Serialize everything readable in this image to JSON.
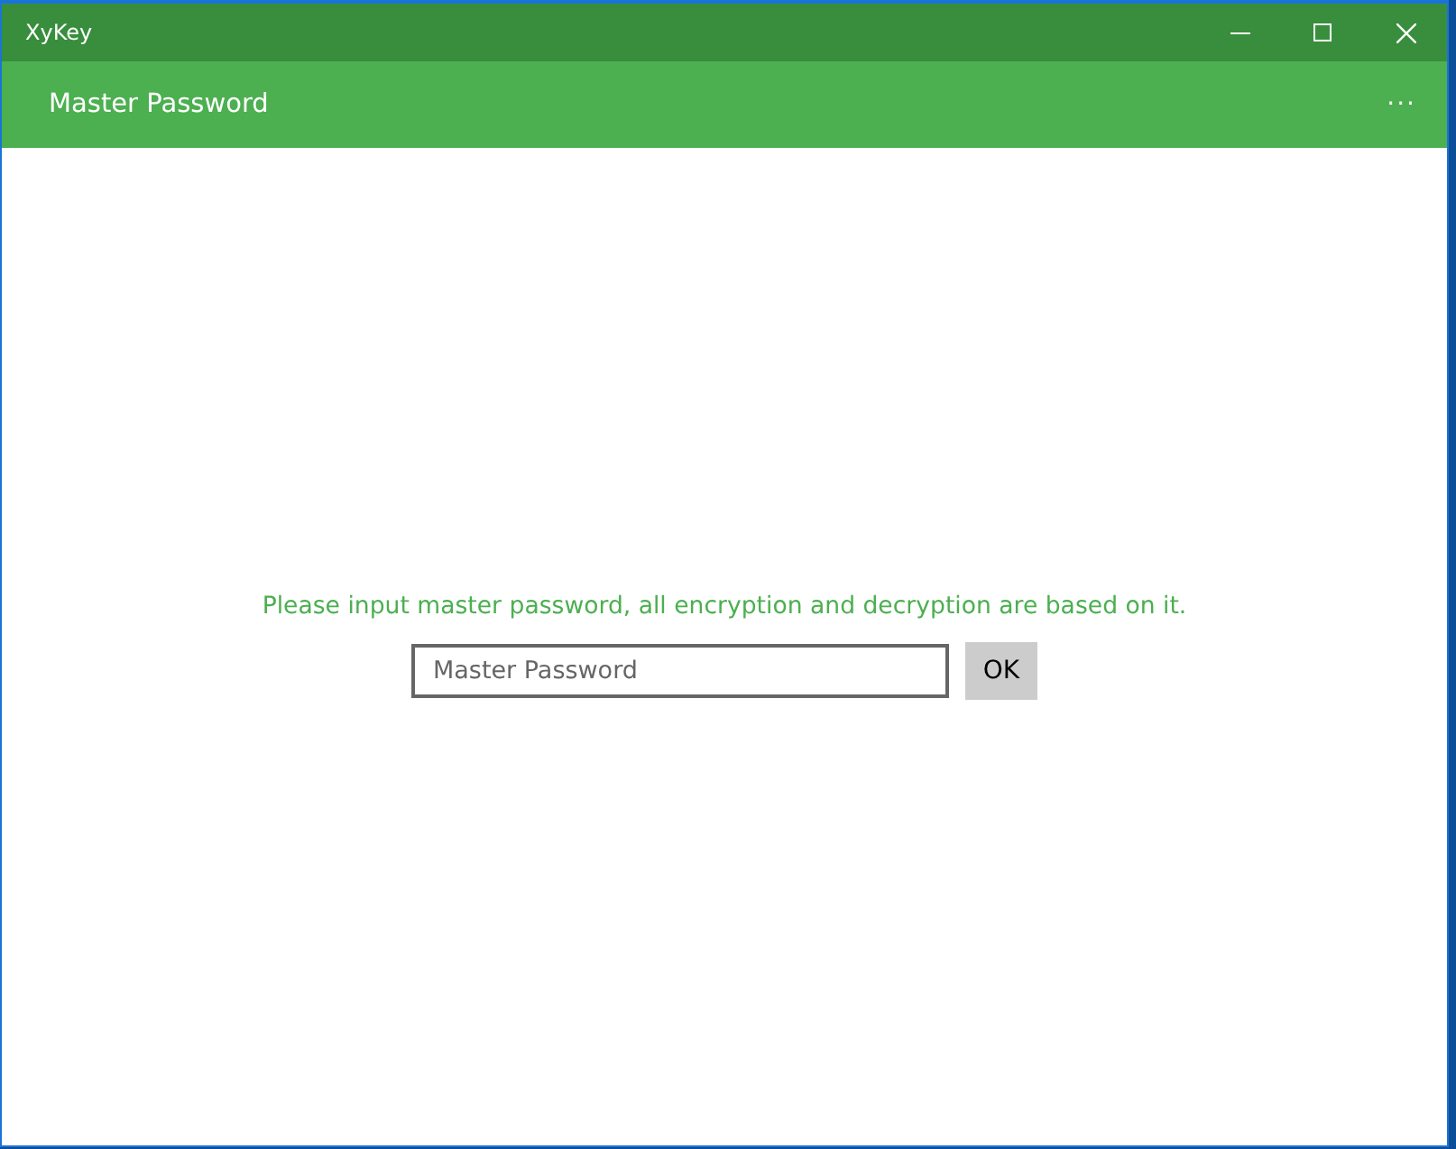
{
  "window": {
    "title": "XyKey"
  },
  "header": {
    "title": "Master Password",
    "more": "···"
  },
  "prompt": "Please input master password, all encryption and decryption are based on it.",
  "password_field": {
    "placeholder": "Master Password"
  },
  "ok_button": "OK"
}
